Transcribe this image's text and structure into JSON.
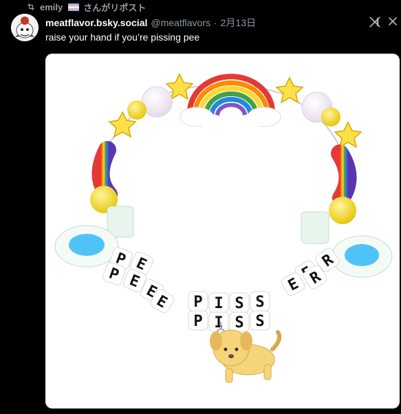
{
  "repost": {
    "user": "emily",
    "suffix": "さんがリポスト"
  },
  "post": {
    "display_name": "meatflavor.bsky.social",
    "handle": "@meatflavors",
    "separator": "·",
    "timestamp": "2月13日",
    "text": "raise your hand if you’re pissing pee"
  },
  "media": {
    "bead_letters_left": [
      "P",
      "E",
      "E",
      "P",
      "E",
      "E"
    ],
    "bead_letters_center": [
      "P",
      "I",
      "S",
      "S",
      "P",
      "I",
      "S",
      "S"
    ],
    "bead_letters_right": [
      "E",
      "R",
      "E",
      "R"
    ]
  },
  "icons": {
    "repost": "repost-icon",
    "flag": "transgender-flag-icon",
    "avatar": "avatar-image",
    "x": "x-logo-icon",
    "close": "close-icon"
  }
}
